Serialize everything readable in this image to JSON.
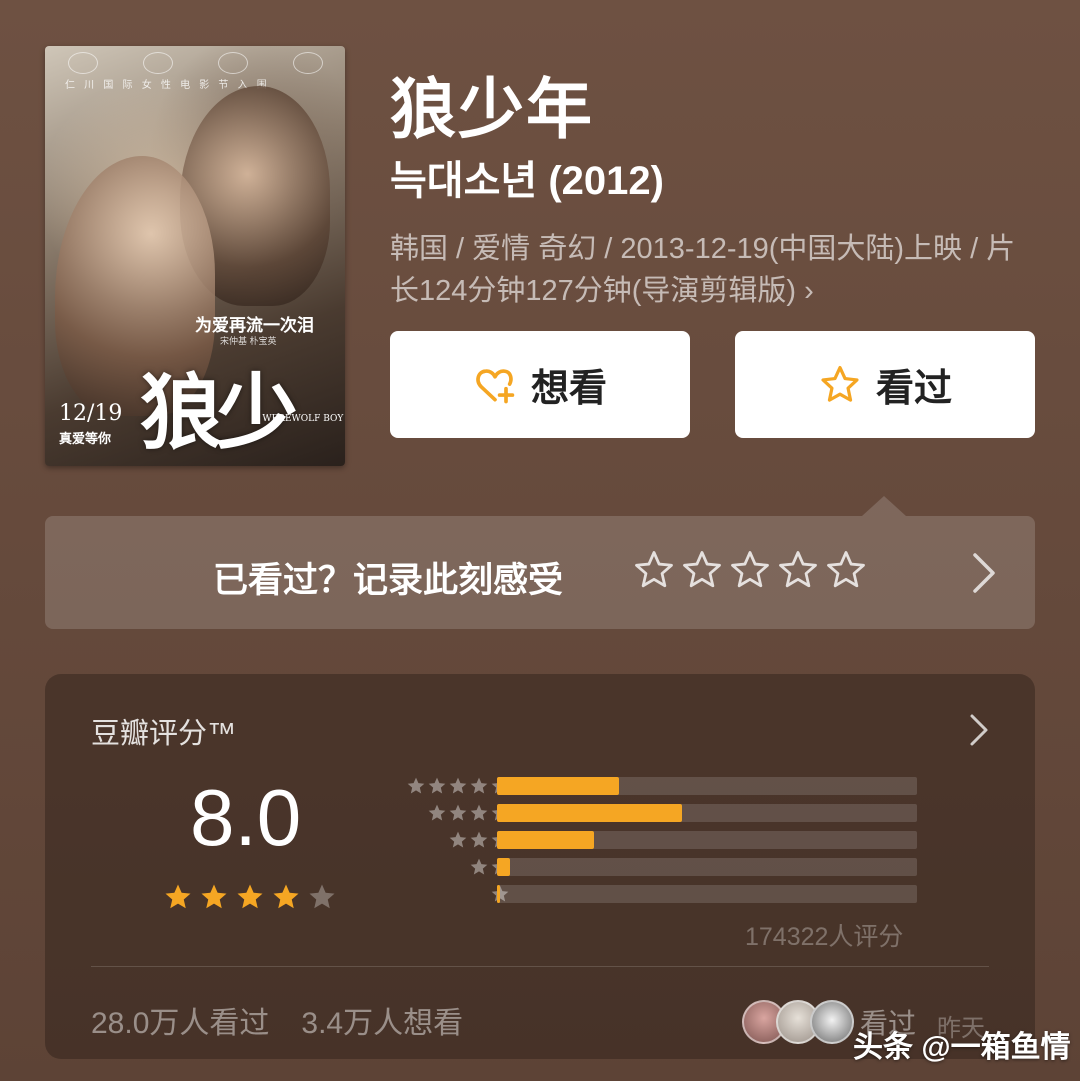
{
  "poster": {
    "credit_line": "仁 川 国 际 女 性 电 影 节 入 围",
    "tagline": "为爱再流一次泪",
    "tagline_sub": "宋仲基 朴宝英",
    "big_title": "狼少年",
    "english_title": "A WEREWOLF BOY",
    "date": "12/19",
    "date_sub": "真爱等你"
  },
  "movie": {
    "title": "狼少年",
    "original_title": "늑대소년 (2012)",
    "meta": "韩国 / 爱情 奇幻 / 2013-12-19(中国大陆)上映 / 片长124分钟127分钟(导演剪辑版) ›"
  },
  "actions": {
    "want_label": "想看",
    "seen_label": "看过"
  },
  "rate_prompt": {
    "text": "已看过？记录此刻感受",
    "star_count": 5
  },
  "rating": {
    "label": "豆瓣评分™",
    "score": "8.0",
    "stars_filled": 4,
    "stars_total": 5,
    "distribution": [
      {
        "stars": 5,
        "fraction": 0.29
      },
      {
        "stars": 4,
        "fraction": 0.44
      },
      {
        "stars": 3,
        "fraction": 0.23
      },
      {
        "stars": 2,
        "fraction": 0.03
      },
      {
        "stars": 1,
        "fraction": 0.007
      }
    ],
    "count": "174322人评分",
    "watched": "28.0万人看过",
    "want": "3.4万人想看",
    "friend_action": "看过",
    "friend_time": "昨天"
  },
  "colors": {
    "accent": "#f5a623",
    "background": "#6b4e3f"
  },
  "watermark": "头条 @一箱鱼情"
}
